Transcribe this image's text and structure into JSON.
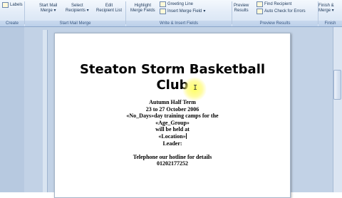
{
  "ribbon": {
    "groups": {
      "create": "Create",
      "start_mail_merge": "Start Mail Merge",
      "write_insert": "Write & Insert Fields",
      "preview_results": "Preview Results",
      "finish": "Finish"
    },
    "buttons": {
      "labels": "Labels",
      "start_mail_merge_1": "Start Mail",
      "start_mail_merge_2": "Merge",
      "select_recipients_1": "Select",
      "select_recipients_2": "Recipients",
      "edit_recipient_list_1": "Edit",
      "edit_recipient_list_2": "Recipient List",
      "highlight_merge_fields_1": "Highlight",
      "highlight_merge_fields_2": "Merge Fields",
      "greeting_line": "Greeting Line",
      "insert_merge_field": "Insert Merge Field",
      "preview_results_1": "Preview",
      "preview_results_2": "Results",
      "find_recipient": "Find Recipient",
      "auto_check_errors": "Auto Check for Errors",
      "finish_merge_1": "Finish &",
      "finish_merge_2": "Merge"
    }
  },
  "document": {
    "title_line1": "Steaton Storm Basketball",
    "title_line2": "Club",
    "lines": [
      "Autumn Half Term",
      "23 to 27 October 2006",
      "«No_Days»day training camps for the",
      "«Age_Group»",
      "will be held at",
      "«Location»",
      "Leader:",
      "",
      "Telephone our hotline for details",
      "01202177252"
    ]
  },
  "colors": {
    "ribbon_top": "#f4f8fd",
    "ribbon_bottom": "#d6e3f3",
    "workspace": "#c2d2e6",
    "highlight": "#ffff5a"
  }
}
